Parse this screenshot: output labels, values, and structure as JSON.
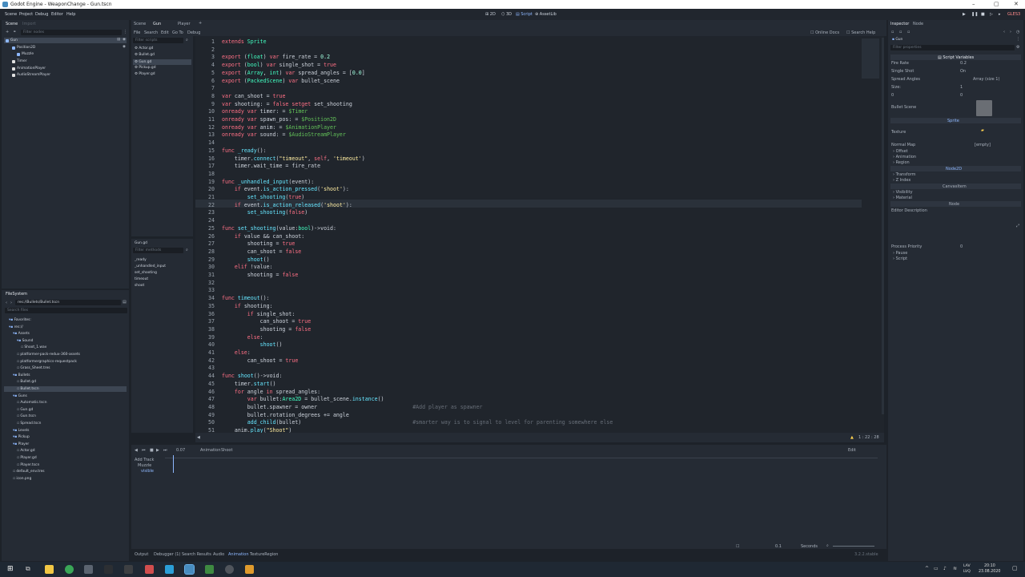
{
  "window": {
    "title": "Godot Engine - WeaponChange - Gun.tscn"
  },
  "menu": [
    "Scene",
    "Project",
    "Debug",
    "Editor",
    "Help"
  ],
  "workspaces": [
    "2D",
    "3D",
    "Script",
    "AssetLib"
  ],
  "renderer": "GLES3",
  "left_dock": {
    "tabs": [
      "Scene",
      "Import"
    ],
    "filter_placeholder": "Filter nodes",
    "tree": [
      "Gun",
      "Position2D",
      "Muzzle",
      "Timer",
      "AnimationPlayer",
      "AudioStreamPlayer"
    ]
  },
  "scene_tabs": [
    "Scene",
    "Gun",
    "Player"
  ],
  "script_menu": [
    "File",
    "Search",
    "Edit",
    "Go To",
    "Debug"
  ],
  "script_links": {
    "docs": "Online Docs",
    "help": "Search Help"
  },
  "script_list": {
    "filter_placeholder": "Filter scripts",
    "items": [
      "Actor.gd",
      "Bullet.gd",
      "Gun.gd",
      "Pickup.gd",
      "Player.gd"
    ]
  },
  "method_list": {
    "current_file": "Gun.gd",
    "filter_placeholder": "Filter methods",
    "items": [
      "_ready",
      "_unhandled_input",
      "set_shooting",
      "timeout",
      "shoot"
    ]
  },
  "filesystem": {
    "title": "FileSystem",
    "path": "res://Bullets/Bullet.tscn",
    "search_placeholder": "Search files",
    "tree": [
      "Favorites:",
      "res://",
      "Assets",
      "Sound",
      "Shoot_1.wav",
      "platformer-pack-redux-360-assets",
      "platformergraphics-requestpack",
      "Grass_Sheet.tres",
      "Bullets",
      "Bullet.gd",
      "Bullet.tscn",
      "Guns",
      "Automatic.tscn",
      "Gun.gd",
      "Gun.tscn",
      "Spread.tscn",
      "Levels",
      "Pickup",
      "Player",
      "Actor.gd",
      "Player.gd",
      "Player.tscn",
      "default_env.tres",
      "icon.png"
    ]
  },
  "code": {
    "lines": [
      "extends Sprite",
      "",
      "export (float) var fire_rate = 0.2",
      "export (bool) var single_shot = true",
      "export (Array, int) var spread_angles = [0.0]",
      "export (PackedScene) var bullet_scene",
      "",
      "var can_shoot = true",
      "var shooting: = false setget set_shooting",
      "onready var timer: = $Timer",
      "onready var spawn_pos: = $Position2D",
      "onready var anim: = $AnimationPlayer",
      "onready var sound: = $AudioStreamPlayer",
      "",
      "func _ready():",
      "    timer.connect(\"timeout\", self, 'timeout')",
      "    timer.wait_time = fire_rate",
      "",
      "func _unhandled_input(event):",
      "    if event.is_action_pressed('shoot'):",
      "        set_shooting(true)",
      "    if event.is_action_released('shoot'):",
      "        set_shooting(false)",
      "",
      "func set_shooting(value:bool)->void:",
      "    if value && can_shoot:",
      "        shooting = true",
      "        can_shoot = false",
      "        shoot()",
      "    elif !value:",
      "        shooting = false",
      "",
      "",
      "func timeout():",
      "    if shooting:",
      "        if single_shot:",
      "            can_shoot = true",
      "            shooting = false",
      "        else:",
      "            shoot()",
      "    else:",
      "        can_shoot = true",
      "",
      "func shoot()->void:",
      "    timer.start()",
      "    for angle in spread_angles:",
      "        var bullet:Area2D = bullet_scene.instance()",
      "        bullet.spawner = owner                              #Add player as spawner",
      "        bullet.rotation_degrees += angle",
      "        add_child(bullet)                                   #smarter way is to signal to level for parenting somewhere else",
      "    anim.play(\"Shoot\")"
    ],
    "cursor": "1 : 22 : 28"
  },
  "animation": {
    "label": "Animation",
    "anim_name": "Shoot",
    "time": "0.07",
    "add_track": "Add Track",
    "tracks": [
      "Muzzle",
      "visible"
    ],
    "step": "0.1",
    "step_unit": "Seconds",
    "edit_label": "Edit"
  },
  "bottom_tabs": [
    "Output",
    "Debugger (1)",
    "Search Results",
    "Audio",
    "Animation",
    "TextureRegion"
  ],
  "version": "3.2.2.stable",
  "inspector": {
    "tabs": [
      "Inspector",
      "Node"
    ],
    "node": "Gun",
    "filter_placeholder": "Filter properties",
    "category": "Script Variables",
    "props": [
      {
        "name": "Fire Rate",
        "value": "0.2"
      },
      {
        "name": "Single Shot",
        "value": "On"
      },
      {
        "name": "Spread Angles",
        "value": "Array (size 1)"
      },
      {
        "name": "Size:",
        "value": "1"
      },
      {
        "name": "0",
        "value": "0"
      },
      {
        "name": "Bullet Scene",
        "value": ""
      }
    ],
    "sprite_section": "Sprite",
    "texture_label": "Texture",
    "normal_map": {
      "label": "Normal Map",
      "value": "[empty]"
    },
    "groups": [
      "Offset",
      "Animation",
      "Region"
    ],
    "node2d_section": "Node2D",
    "node2d_groups": [
      "Transform",
      "Z Index"
    ],
    "canvas_section": "CanvasItem",
    "canvas_groups": [
      "Visibility",
      "Material"
    ],
    "node_section": "Node",
    "editor_desc": "Editor Description",
    "process_priority": {
      "label": "Process Priority",
      "value": "0"
    },
    "node_groups": [
      "Pause",
      "Script"
    ]
  },
  "taskbar": {
    "lang": "LAV",
    "lang2": "LVQ",
    "time": "20:10",
    "date": "23.08.2020"
  },
  "colors": {
    "accent": "#478cbf",
    "selected": "#3d4653",
    "panel": "#252b34",
    "editor": "#20252c"
  }
}
